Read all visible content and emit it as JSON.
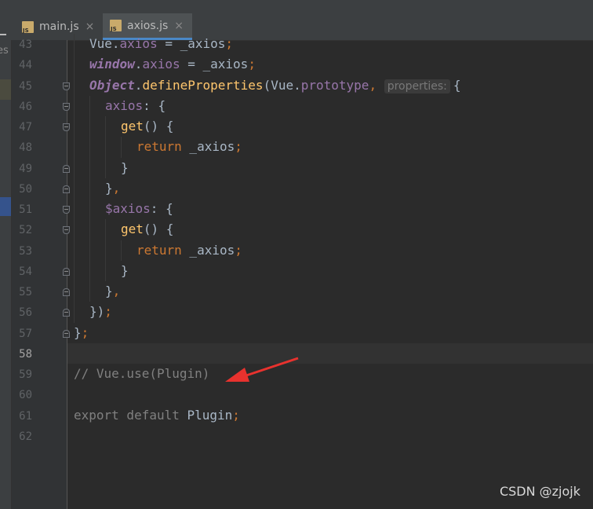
{
  "tabs": [
    {
      "label": "main.js",
      "icon": "js-file-icon",
      "active": false
    },
    {
      "label": "axios.js",
      "icon": "js-file-icon",
      "active": true
    }
  ],
  "close_glyph": "×",
  "left_panel_fragment": "es",
  "current_line": 58,
  "code_lines": [
    {
      "num": "43",
      "indent": 1,
      "tokens": [
        {
          "t": "Vue.",
          "c": ""
        },
        {
          "t": "axios",
          "c": "tok-prop"
        },
        {
          "t": " = _axios",
          "c": ""
        },
        {
          "t": ";",
          "c": "tok-punct"
        }
      ]
    },
    {
      "num": "44",
      "indent": 1,
      "tokens": [
        {
          "t": "window",
          "c": "tok-glob"
        },
        {
          "t": ".",
          "c": ""
        },
        {
          "t": "axios",
          "c": "tok-prop"
        },
        {
          "t": " = _axios",
          "c": ""
        },
        {
          "t": ";",
          "c": "tok-punct"
        }
      ]
    },
    {
      "num": "45",
      "indent": 1,
      "fold": "open",
      "tokens": [
        {
          "t": "Object",
          "c": "tok-glob"
        },
        {
          "t": ".",
          "c": ""
        },
        {
          "t": "defineProperties",
          "c": "tok-fn"
        },
        {
          "t": "(Vue.",
          "c": ""
        },
        {
          "t": "prototype",
          "c": "tok-prop"
        },
        {
          "t": ", ",
          "c": "tok-punct"
        },
        {
          "t": "properties:",
          "c": "inlay"
        },
        {
          "t": "{",
          "c": ""
        }
      ]
    },
    {
      "num": "46",
      "indent": 2,
      "fold": "open",
      "tokens": [
        {
          "t": "axios",
          "c": "tok-prop"
        },
        {
          "t": ": {",
          "c": ""
        }
      ]
    },
    {
      "num": "47",
      "indent": 3,
      "fold": "open",
      "tokens": [
        {
          "t": "get",
          "c": "tok-fn"
        },
        {
          "t": "() {",
          "c": ""
        }
      ]
    },
    {
      "num": "48",
      "indent": 4,
      "tokens": [
        {
          "t": "return",
          "c": "tok-kw"
        },
        {
          "t": " _axios",
          "c": ""
        },
        {
          "t": ";",
          "c": "tok-punct"
        }
      ]
    },
    {
      "num": "49",
      "indent": 3,
      "fold": "close",
      "tokens": [
        {
          "t": "}",
          "c": ""
        }
      ]
    },
    {
      "num": "50",
      "indent": 2,
      "fold": "close",
      "tokens": [
        {
          "t": "}",
          "c": ""
        },
        {
          "t": ",",
          "c": "tok-punct"
        }
      ]
    },
    {
      "num": "51",
      "indent": 2,
      "fold": "open",
      "tokens": [
        {
          "t": "$axios",
          "c": "tok-prop"
        },
        {
          "t": ": {",
          "c": ""
        }
      ]
    },
    {
      "num": "52",
      "indent": 3,
      "fold": "open",
      "tokens": [
        {
          "t": "get",
          "c": "tok-fn"
        },
        {
          "t": "() {",
          "c": ""
        }
      ]
    },
    {
      "num": "53",
      "indent": 4,
      "tokens": [
        {
          "t": "return",
          "c": "tok-kw"
        },
        {
          "t": " _axios",
          "c": ""
        },
        {
          "t": ";",
          "c": "tok-punct"
        }
      ]
    },
    {
      "num": "54",
      "indent": 3,
      "fold": "close",
      "tokens": [
        {
          "t": "}",
          "c": ""
        }
      ]
    },
    {
      "num": "55",
      "indent": 2,
      "fold": "close",
      "tokens": [
        {
          "t": "}",
          "c": ""
        },
        {
          "t": ",",
          "c": "tok-punct"
        }
      ]
    },
    {
      "num": "56",
      "indent": 1,
      "fold": "close",
      "tokens": [
        {
          "t": "})",
          "c": ""
        },
        {
          "t": ";",
          "c": "tok-punct"
        }
      ]
    },
    {
      "num": "57",
      "indent": 0,
      "fold": "close",
      "tokens": [
        {
          "t": "}",
          "c": ""
        },
        {
          "t": ";",
          "c": "tok-punct"
        }
      ]
    },
    {
      "num": "58",
      "indent": 0,
      "tokens": []
    },
    {
      "num": "59",
      "indent": 0,
      "tokens": [
        {
          "t": "// Vue.use(Plugin)",
          "c": "tok-cmt"
        }
      ]
    },
    {
      "num": "60",
      "indent": 0,
      "tokens": []
    },
    {
      "num": "61",
      "indent": 0,
      "tokens": [
        {
          "t": "export default ",
          "c": "tok-cmt"
        },
        {
          "t": "Plugin",
          "c": ""
        },
        {
          "t": ";",
          "c": "tok-punct"
        }
      ]
    },
    {
      "num": "62",
      "indent": 0,
      "tokens": []
    }
  ],
  "annotation_arrow": {
    "color": "#e8322e",
    "points_to_line": "59"
  },
  "watermark": "CSDN @zjojk",
  "colors": {
    "background": "#2b2b2b",
    "gutter": "#313335",
    "text": "#a9b7c6",
    "keyword": "#cc7832",
    "property": "#9876aa",
    "function": "#ffc66d",
    "comment": "#808080"
  }
}
